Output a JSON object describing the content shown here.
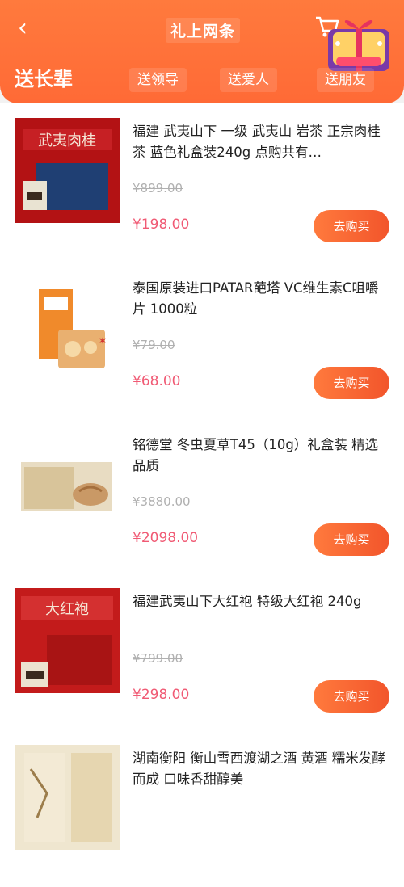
{
  "header": {
    "back_label": "‹",
    "title": "礼上网条",
    "colors": {
      "primary": "#ff6f3a",
      "price": "#f05a74"
    }
  },
  "tabs": [
    {
      "label": "送长辈",
      "active": true
    },
    {
      "label": "送领导",
      "active": false
    },
    {
      "label": "送爱人",
      "active": false
    },
    {
      "label": "送朋友",
      "active": false
    }
  ],
  "products": [
    {
      "name": "福建 武夷山下 一级 武夷山 岩茶 正宗肉桂茶 蓝色礼盒装240g 点购共有…",
      "original_price": "¥899.00",
      "price": "¥198.00",
      "button": "去购买",
      "image_icon": "tea-gift-box-blue"
    },
    {
      "name": "泰国原装进口PATAR葩塔 VC维生素C咀嚼片 1000粒",
      "original_price": "¥79.00",
      "price": "¥68.00",
      "button": "去购买",
      "image_icon": "vitamin-box"
    },
    {
      "name": "铭德堂 冬虫夏草T45（10g）礼盒装 精选品质",
      "original_price": "¥3880.00",
      "price": "¥2098.00",
      "button": "去购买",
      "image_icon": "cordyceps-gift-box"
    },
    {
      "name": "福建武夷山下大红袍 特级大红袍 240g",
      "original_price": "¥799.00",
      "price": "¥298.00",
      "button": "去购买",
      "image_icon": "red-robe-tea-box"
    },
    {
      "name": "湖南衡阳 衡山雪西渡湖之酒 黄酒 糯米发酵而成 口味香甜醇美",
      "original_price": "",
      "price": "",
      "button": "",
      "image_icon": "rice-wine-box"
    }
  ]
}
